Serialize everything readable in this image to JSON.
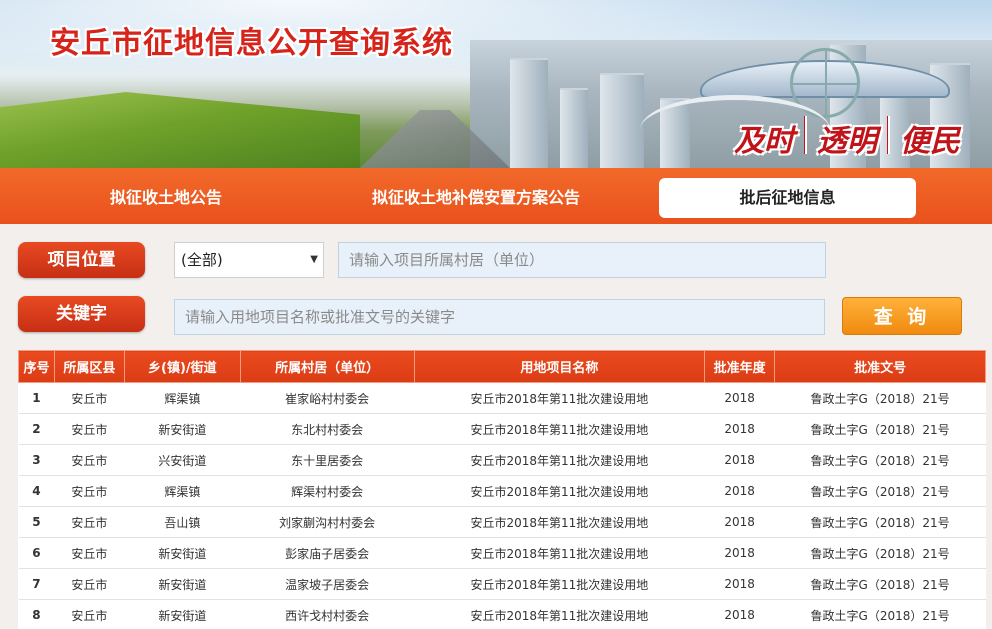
{
  "banner": {
    "title": "安丘市征地信息公开查询系统",
    "slogan": [
      "及时",
      "透明",
      "便民"
    ]
  },
  "nav": {
    "tabs": [
      {
        "label": "拟征收土地公告",
        "active": false
      },
      {
        "label": "拟征收土地补偿安置方案公告",
        "active": false
      },
      {
        "label": "批后征地信息",
        "active": true
      }
    ]
  },
  "filters": {
    "location_label": "项目位置",
    "location_select": "(全部)",
    "village_placeholder": "请输入项目所属村居（单位）",
    "keyword_label": "关键字",
    "keyword_placeholder": "请输入用地项目名称或批准文号的关键字",
    "query_button": "查 询"
  },
  "table": {
    "headers": [
      "序号",
      "所属区县",
      "乡(镇)/街道",
      "所属村居（单位）",
      "用地项目名称",
      "批准年度",
      "批准文号"
    ],
    "rows": [
      [
        "1",
        "安丘市",
        "辉渠镇",
        "崔家峪村村委会",
        "安丘市2018年第11批次建设用地",
        "2018",
        "鲁政土字G（2018）21号"
      ],
      [
        "2",
        "安丘市",
        "新安街道",
        "东北村村委会",
        "安丘市2018年第11批次建设用地",
        "2018",
        "鲁政土字G（2018）21号"
      ],
      [
        "3",
        "安丘市",
        "兴安街道",
        "东十里居委会",
        "安丘市2018年第11批次建设用地",
        "2018",
        "鲁政土字G（2018）21号"
      ],
      [
        "4",
        "安丘市",
        "辉渠镇",
        "辉渠村村委会",
        "安丘市2018年第11批次建设用地",
        "2018",
        "鲁政土字G（2018）21号"
      ],
      [
        "5",
        "安丘市",
        "吾山镇",
        "刘家蒯沟村村委会",
        "安丘市2018年第11批次建设用地",
        "2018",
        "鲁政土字G（2018）21号"
      ],
      [
        "6",
        "安丘市",
        "新安街道",
        "彭家庙子居委会",
        "安丘市2018年第11批次建设用地",
        "2018",
        "鲁政土字G（2018）21号"
      ],
      [
        "7",
        "安丘市",
        "新安街道",
        "温家坡子居委会",
        "安丘市2018年第11批次建设用地",
        "2018",
        "鲁政土字G（2018）21号"
      ],
      [
        "8",
        "安丘市",
        "新安街道",
        "西许戈村村委会",
        "安丘市2018年第11批次建设用地",
        "2018",
        "鲁政土字G（2018）21号"
      ]
    ]
  }
}
